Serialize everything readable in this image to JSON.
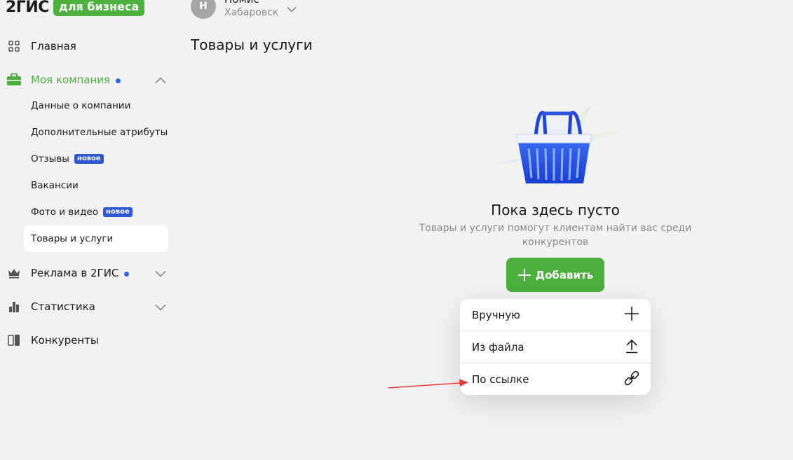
{
  "logo": {
    "mark": "2ГИС",
    "badge": "для бизнеса"
  },
  "company": {
    "avatar_letter": "Н",
    "name": "Номис",
    "city": "Хабаровск"
  },
  "page": {
    "title": "Товары и услуги"
  },
  "nav": {
    "home": "Главная",
    "my_company": "Моя компания",
    "sub": {
      "data": "Данные о компании",
      "attributes": "Дополнительные атрибуты",
      "reviews": "Отзывы",
      "reviews_badge": "новое",
      "vacancies": "Вакансии",
      "media": "Фото и видео",
      "media_badge": "новое",
      "products": "Товары и услуги"
    },
    "ads": "Реклама в 2ГИС",
    "stats": "Статистика",
    "competitors": "Конкуренты"
  },
  "empty": {
    "title": "Пока здесь пусто",
    "subtitle": "Товары и услуги помогут клиентам найти вас среди конкурентов"
  },
  "add_button": {
    "label": "Добавить"
  },
  "add_menu": {
    "manual": "Вручную",
    "from_file": "Из файла",
    "by_link": "По ссылке"
  },
  "colors": {
    "brand_green": "#4caf3e",
    "dot_blue": "#2e66e8",
    "badge_blue": "#2e57d6",
    "arrow_red": "#e53935"
  }
}
